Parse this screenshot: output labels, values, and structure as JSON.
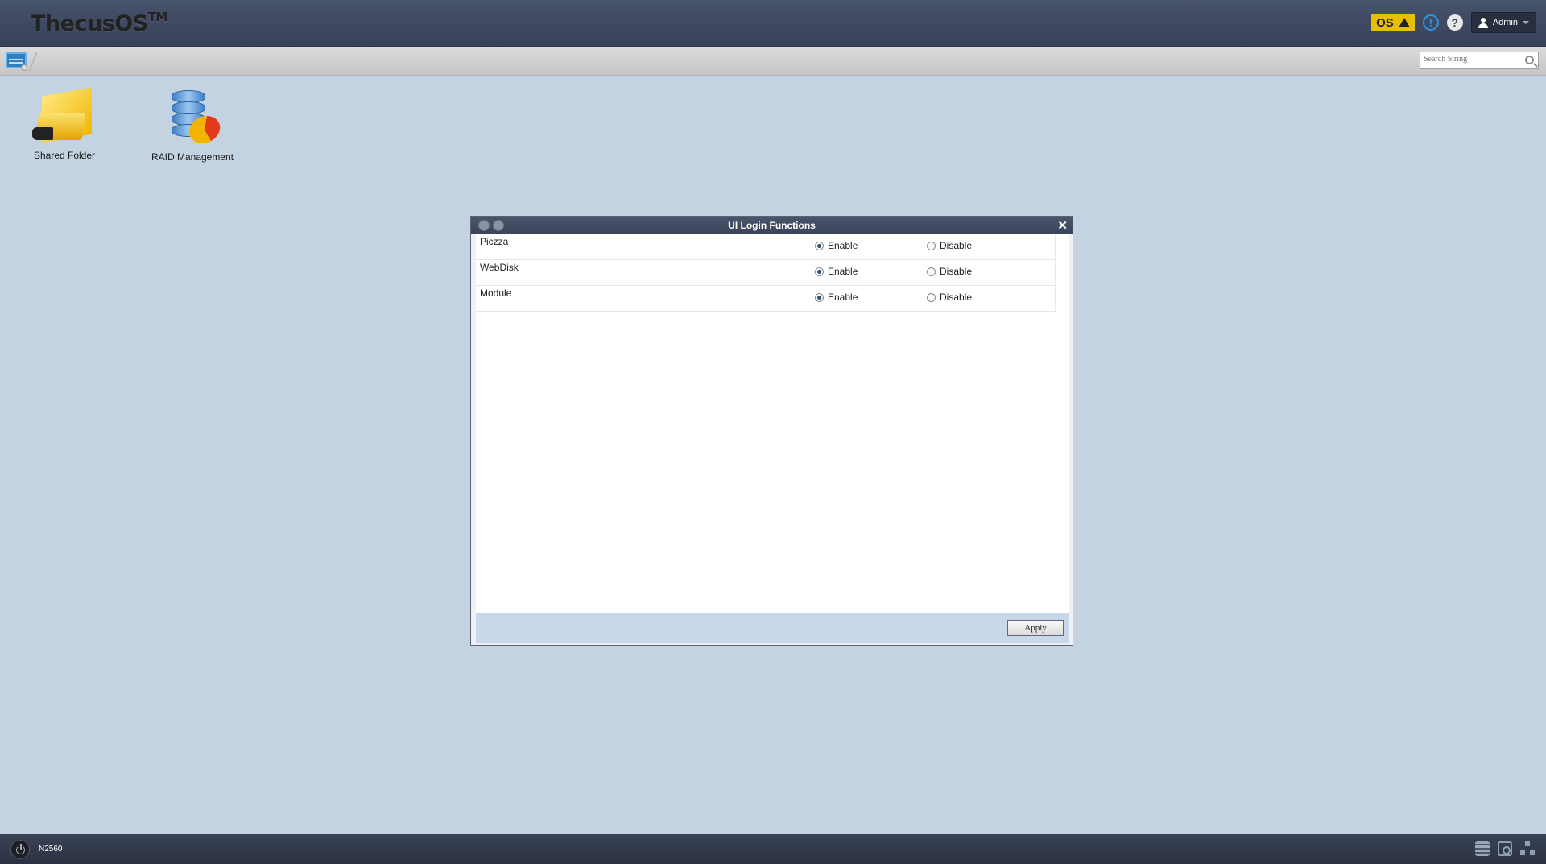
{
  "header": {
    "logo_text": "ThecusOS",
    "logo_tm": "TM",
    "os_badge": "OS",
    "info_symbol": "!",
    "help_symbol": "?",
    "user_label": "Admin"
  },
  "toolbar": {
    "search_placeholder": "Search String"
  },
  "desktop": {
    "icons": [
      {
        "label": "Shared Folder",
        "icon": "shared-folder-icon"
      },
      {
        "label": "RAID Management",
        "icon": "raid-management-icon"
      }
    ]
  },
  "window": {
    "title": "UI Login Functions",
    "close_symbol": "✕",
    "rows": [
      {
        "name": "Piczza",
        "enable_label": "Enable",
        "disable_label": "Disable",
        "value": "Enable"
      },
      {
        "name": "WebDisk",
        "enable_label": "Enable",
        "disable_label": "Disable",
        "value": "Enable"
      },
      {
        "name": "Module",
        "enable_label": "Enable",
        "disable_label": "Disable",
        "value": "Enable"
      }
    ],
    "apply_label": "Apply"
  },
  "taskbar": {
    "model": "N2560"
  },
  "colors": {
    "desktop_bg": "#c4d3e2",
    "topbar_bg": "#3f4a60",
    "os_badge": "#e9c000",
    "info_accent": "#2f8fe0"
  }
}
